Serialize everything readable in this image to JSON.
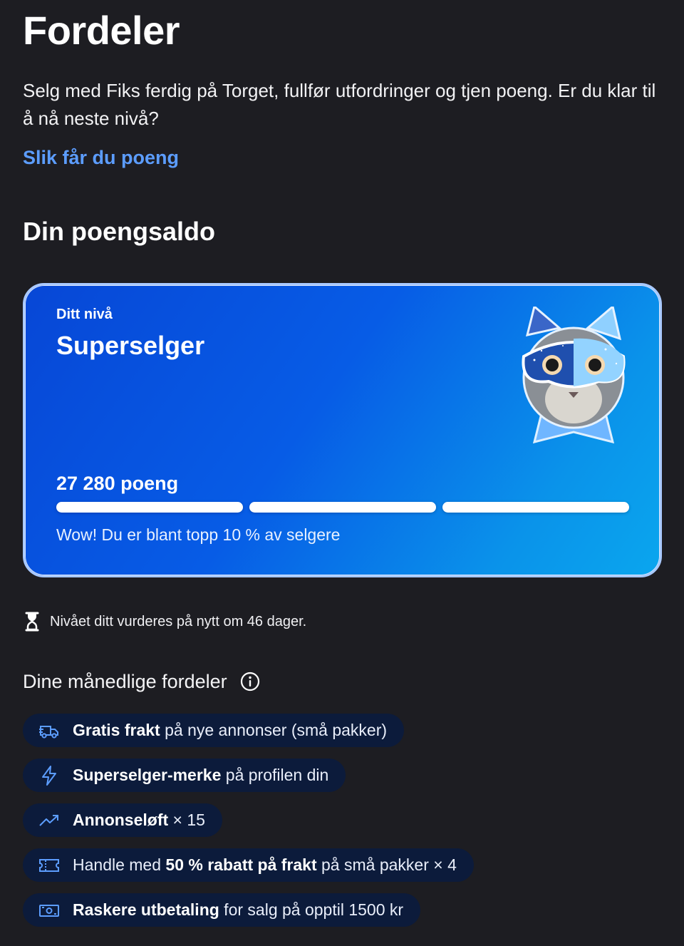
{
  "header": {
    "title": "Fordeler",
    "intro": "Selg med Fiks ferdig på Torget, fullfør utfordringer og tjen poeng. Er du klar til å nå neste nivå?",
    "link_label": "Slik får du poeng"
  },
  "balance": {
    "section_title": "Din poengsaldo",
    "level_label": "Ditt nivå",
    "level_name": "Superselger",
    "points": "27 280 poeng",
    "progress_segments_filled": 3,
    "progress_segments_total": 3,
    "status_text": "Wow! Du er blant topp 10 % av selgere",
    "mascot_icon": "masked-cat-badge"
  },
  "notice": {
    "icon": "hourglass-icon",
    "text": "Nivået ditt vurderes på nytt om 46 dager."
  },
  "benefits": {
    "heading": "Dine månedlige fordeler",
    "info_icon": "info-icon",
    "items": [
      {
        "icon": "truck-icon",
        "pre": "",
        "bold": "Gratis frakt",
        "rest": " på nye annonser (små pakker)"
      },
      {
        "icon": "lightning-icon",
        "pre": "",
        "bold": "Superselger-merke",
        "rest": " på profilen din"
      },
      {
        "icon": "trend-up-icon",
        "pre": "",
        "bold": "Annonseløft",
        "rest": " × 15"
      },
      {
        "icon": "ticket-icon",
        "pre": "Handle med ",
        "bold": "50 % rabatt på frakt",
        "rest": " på små pakker × 4"
      },
      {
        "icon": "banknote-icon",
        "pre": "",
        "bold": "Raskere utbetaling",
        "rest": " for salg på opptil 1500 kr"
      }
    ]
  },
  "colors": {
    "background": "#1d1d22",
    "link": "#5c9dff",
    "card_gradient_start": "#0747d6",
    "card_gradient_end": "#0aa6ee",
    "pill_background": "#0c1b3b"
  }
}
